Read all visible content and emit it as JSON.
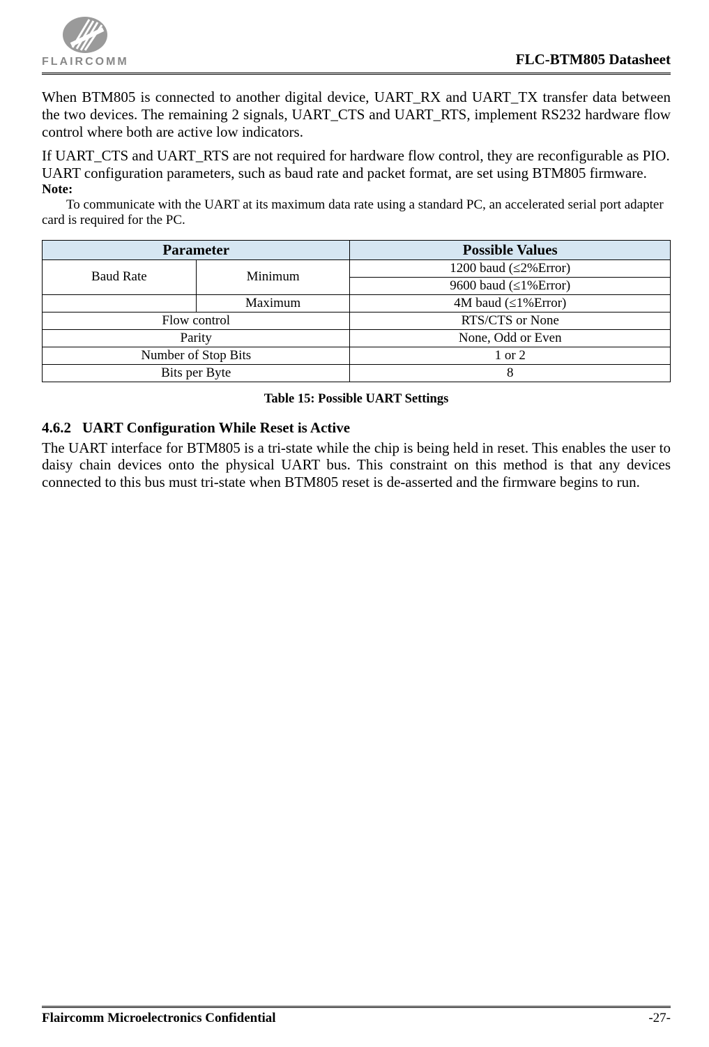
{
  "header": {
    "logo_text": "FLAIRCOMM",
    "doc_title": "FLC-BTM805 Datasheet"
  },
  "paragraphs": {
    "p1": "When BTM805 is connected to another digital device, UART_RX and UART_TX transfer data between the two devices. The remaining 2 signals, UART_CTS and UART_RTS, implement RS232 hardware flow control where both are active low indicators.",
    "p2": "If UART_CTS and UART_RTS are not required for hardware flow control, they are reconfigurable as PIO.",
    "p3": "UART configuration parameters, such as baud rate and packet format, are set using BTM805 firmware.",
    "note_label": "Note:",
    "note_text": "To communicate with the UART at its maximum data rate using a standard PC, an accelerated serial port adapter card is required for the PC."
  },
  "table": {
    "headers": {
      "param": "Parameter",
      "values": "Possible Values"
    },
    "rows": {
      "baud_rate_label": "Baud Rate",
      "minimum_label": "Minimum",
      "maximum_label": "Maximum",
      "min_val1": "1200 baud (≤2%Error)",
      "min_val2": "9600 baud (≤1%Error)",
      "max_val": "4M baud (≤1%Error)",
      "flow_label": "Flow control",
      "flow_val": "RTS/CTS or None",
      "parity_label": "Parity",
      "parity_val": "None, Odd or Even",
      "stopbits_label": "Number of Stop Bits",
      "stopbits_val": "1 or 2",
      "bitsperbyte_label": "Bits per Byte",
      "bitsperbyte_val": "8"
    },
    "caption": "Table 15: Possible UART Settings"
  },
  "section": {
    "number": "4.6.2",
    "title": "UART Configuration While Reset is Active",
    "body": "The UART interface for BTM805 is a tri-state while the chip is being held in reset. This enables the user to daisy chain devices onto the physical UART bus. This constraint on this method is that any devices connected to this bus must tri-state when BTM805 reset is de-asserted and the firmware begins to run."
  },
  "footer": {
    "left": "Flaircomm Microelectronics Confidential",
    "right": "-27-"
  }
}
